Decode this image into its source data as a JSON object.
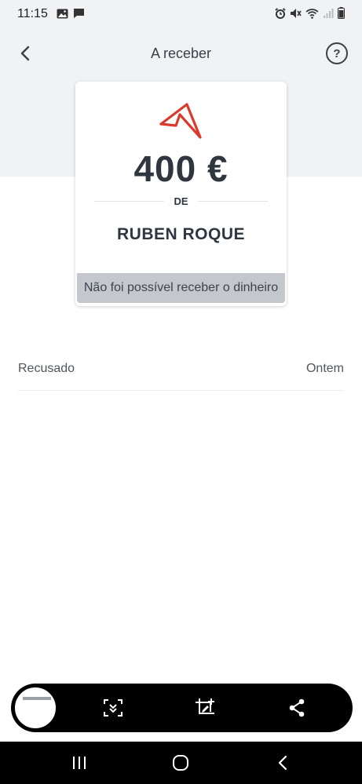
{
  "status_bar": {
    "time": "11:15"
  },
  "app_bar": {
    "title": "A receber",
    "help_label": "?"
  },
  "card": {
    "amount": "400 €",
    "from_label": "DE",
    "name": "RUBEN ROQUE",
    "status_text": "Não foi possível receber o dinheiro"
  },
  "details": {
    "label": "Recusado",
    "value": "Ontem"
  },
  "colors": {
    "accent": "#d93a2b",
    "top_background": "#f1f2f4",
    "status_strip": "#c4c7cc"
  }
}
